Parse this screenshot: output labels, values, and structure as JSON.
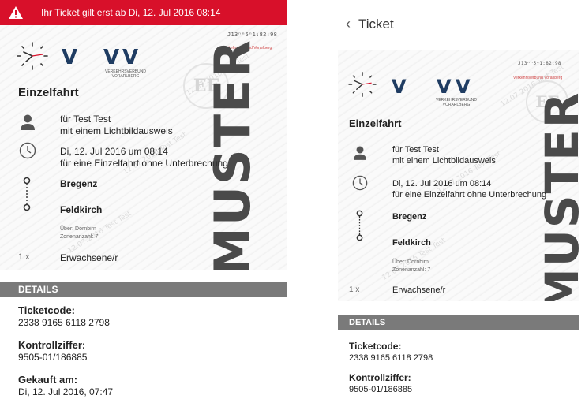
{
  "alert": {
    "text": "Ihr Ticket gilt erst ab Di, 12. Jul 2016 08:14"
  },
  "nav": {
    "back_icon": "chevron-left-icon",
    "title": "Ticket"
  },
  "ticket": {
    "code_top_right": "J13ⁿⁿ5ⁿ1:82:98",
    "small_red": "Verkehrsverbund Vorarlberg",
    "logo": {
      "v1": "V",
      "v2": "V",
      "v3": "V",
      "line1": "VERKEHRSVERBUND",
      "line2": "VORARLBERG"
    },
    "type_title": "Einzelfahrt",
    "passenger_line1": "für Test Test",
    "passenger_line2": "mit einem Lichtbildausweis",
    "validity_line1": "Di, 12. Jul 2016 um 08:14",
    "validity_line2": "für eine Einzelfahrt ohne Unterbrechung",
    "from": "Bregenz",
    "to": "Feldkirch",
    "via_line1": "Über: Dornbirn",
    "via_line2": "Zonenanzahl: 7",
    "quantity": "1 x",
    "fare_class": "Erwachsene/r",
    "muster": "MUSTER",
    "seal": "EF",
    "watermark": "12.07.2016 Test Test"
  },
  "details": {
    "header": "DETAILS",
    "ticketcode_label": "Ticketcode:",
    "ticketcode_value": "2338 9165 6118 2798",
    "kontroll_label": "Kontrollziffer:",
    "kontroll_value": "9505-01/186885",
    "gekauft_label": "Gekauft am:",
    "gekauft_value": "Di, 12. Jul 2016, 07:47"
  },
  "colors": {
    "alert": "#d8102a",
    "details_bar": "#7a7a7a",
    "logo": "#1f3c62"
  },
  "icons": {
    "alert": "warning-icon",
    "clock_logo": "clock-logo-icon",
    "person": "person-icon",
    "time": "clock-icon",
    "route": "route-icon"
  }
}
